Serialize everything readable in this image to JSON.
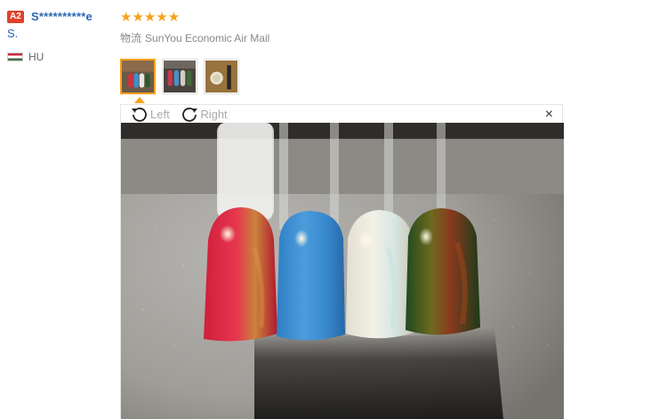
{
  "review": {
    "badge": "A2",
    "username_line1": "S**********e",
    "username_line2": "S.",
    "country_code": "HU",
    "stars": "★★★★★",
    "rating": 5,
    "shipping_label": "物流",
    "shipping_method": "SunYou Economic Air Mail"
  },
  "viewer": {
    "rotate_left": "Left",
    "rotate_right": "Right",
    "close": "×",
    "active_thumbnail": 1
  },
  "colors": {
    "accent": "#f7a21b",
    "link": "#2a66b4",
    "badge": "#e0402b"
  },
  "icons": [
    "rotate-left-icon",
    "rotate-right-icon",
    "close-icon",
    "hungary-flag-icon",
    "star-icon"
  ]
}
